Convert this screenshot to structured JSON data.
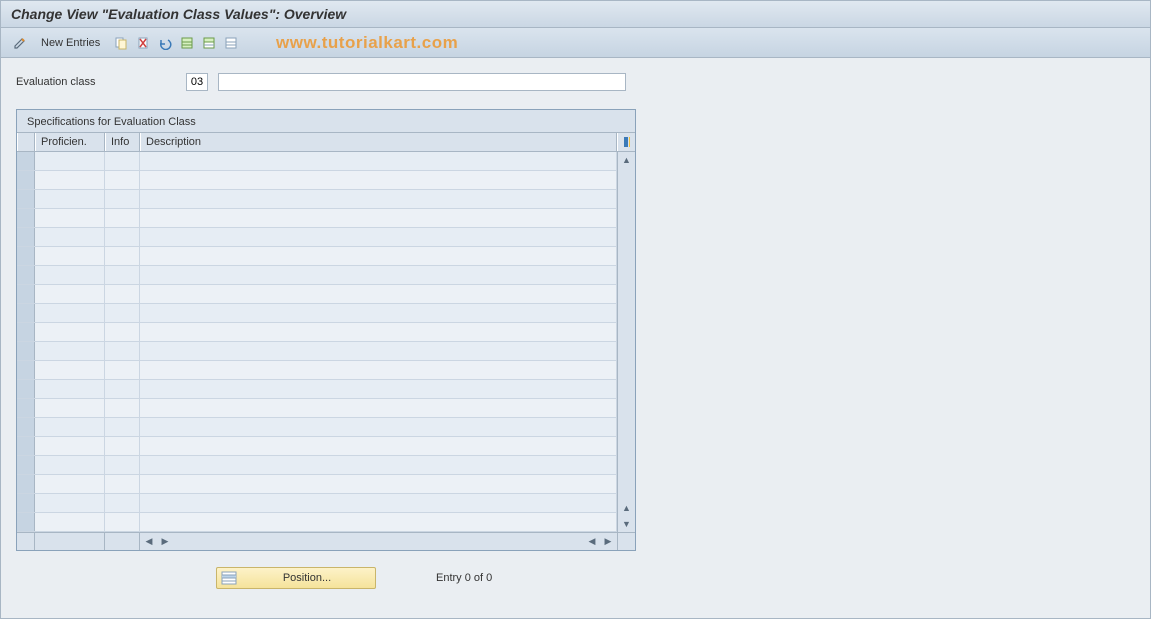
{
  "title": "Change View \"Evaluation Class Values\": Overview",
  "toolbar": {
    "new_entries_label": "New Entries"
  },
  "watermark": "www.tutorialkart.com",
  "fields": {
    "eval_class_label": "Evaluation class",
    "eval_class_value": "03",
    "eval_class_desc": ""
  },
  "table": {
    "title": "Specifications for Evaluation Class",
    "columns": {
      "proficiency": "Proficien.",
      "info": "Info",
      "description": "Description"
    },
    "rows": [
      {
        "prof": "",
        "info": "",
        "desc": ""
      },
      {
        "prof": "",
        "info": "",
        "desc": ""
      },
      {
        "prof": "",
        "info": "",
        "desc": ""
      },
      {
        "prof": "",
        "info": "",
        "desc": ""
      },
      {
        "prof": "",
        "info": "",
        "desc": ""
      },
      {
        "prof": "",
        "info": "",
        "desc": ""
      },
      {
        "prof": "",
        "info": "",
        "desc": ""
      },
      {
        "prof": "",
        "info": "",
        "desc": ""
      },
      {
        "prof": "",
        "info": "",
        "desc": ""
      },
      {
        "prof": "",
        "info": "",
        "desc": ""
      },
      {
        "prof": "",
        "info": "",
        "desc": ""
      },
      {
        "prof": "",
        "info": "",
        "desc": ""
      },
      {
        "prof": "",
        "info": "",
        "desc": ""
      },
      {
        "prof": "",
        "info": "",
        "desc": ""
      },
      {
        "prof": "",
        "info": "",
        "desc": ""
      },
      {
        "prof": "",
        "info": "",
        "desc": ""
      },
      {
        "prof": "",
        "info": "",
        "desc": ""
      },
      {
        "prof": "",
        "info": "",
        "desc": ""
      },
      {
        "prof": "",
        "info": "",
        "desc": ""
      },
      {
        "prof": "",
        "info": "",
        "desc": ""
      }
    ]
  },
  "footer": {
    "position_label": "Position...",
    "entry_text": "Entry 0 of 0"
  }
}
